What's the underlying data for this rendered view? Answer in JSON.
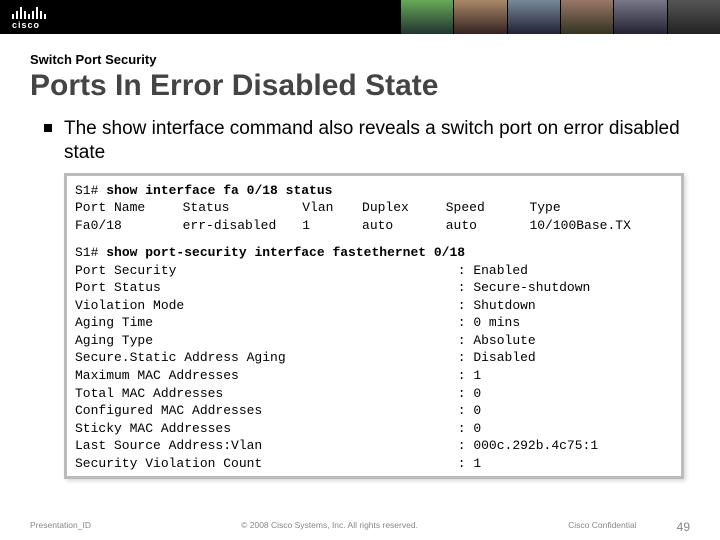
{
  "brand": "cisco",
  "supertitle": "Switch Port Security",
  "title": "Ports In Error Disabled State",
  "bullet": "The show interface command also reveals a switch port on error disabled state",
  "cli": {
    "prompt": "S1#",
    "cmd1": "show interface fa 0/18 status",
    "cols": [
      "Port Name",
      "Status",
      "Vlan",
      "Duplex",
      "Speed",
      "Type"
    ],
    "row": [
      "Fa0/18",
      "err-disabled",
      "1",
      "auto",
      "auto",
      "10/100Base.TX"
    ],
    "cmd2": "show port-security interface fastethernet 0/18",
    "kv": [
      [
        "Port Security",
        "Enabled"
      ],
      [
        "Port Status",
        "Secure-shutdown"
      ],
      [
        "Violation Mode",
        "Shutdown"
      ],
      [
        "Aging Time",
        "0 mins"
      ],
      [
        "Aging Type",
        "Absolute"
      ],
      [
        "Secure.Static Address Aging",
        "Disabled"
      ],
      [
        "Maximum MAC Addresses",
        "1"
      ],
      [
        "Total MAC Addresses",
        "0"
      ],
      [
        "Configured MAC Addresses",
        "0"
      ],
      [
        "Sticky MAC Addresses",
        "0"
      ],
      [
        "Last Source Address:Vlan",
        "000c.292b.4c75:1"
      ],
      [
        "Security Violation Count",
        "1"
      ]
    ]
  },
  "footer": {
    "pid": "Presentation_ID",
    "copy": "© 2008 Cisco Systems, Inc. All rights reserved.",
    "conf": "Cisco Confidential",
    "page": "49"
  }
}
